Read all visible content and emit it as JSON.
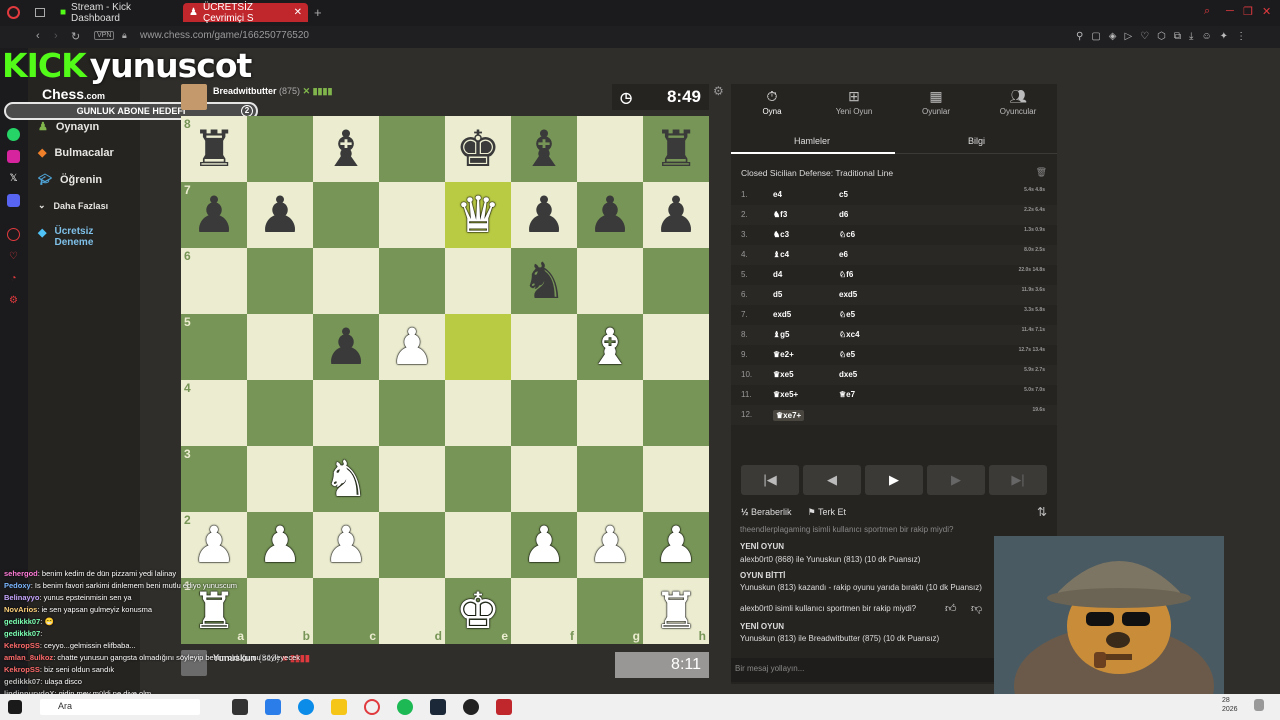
{
  "browser": {
    "tab1": "Stream - Kick Dashboard",
    "tab2": "ÜCRETSİZ Çevrimiçi S",
    "url": "www.chess.com/game/166250776520",
    "vpn": "VPN"
  },
  "overlay": {
    "kick": "KICK",
    "streamer": "yunuscot",
    "goal_label": "GUNLUK ABONE HEDEFI",
    "goal_count": "2"
  },
  "sidebar": {
    "brand": "Chess",
    "brand_suffix": ".com",
    "items": [
      "Oynayın",
      "Bulmacalar",
      "Öğrenin",
      "Daha Fazlası"
    ],
    "premium": "Ücretsiz Deneme"
  },
  "top_player": {
    "name": "Breadwitbutter",
    "rating": "(875)",
    "clock": "8:49"
  },
  "bottom_player": {
    "name": "Yunuskun",
    "rating": "(813)",
    "clock": "8:11"
  },
  "board": {
    "ranks": [
      "8",
      "7",
      "6",
      "5",
      "4",
      "3",
      "2",
      "1"
    ],
    "files": [
      "a",
      "b",
      "c",
      "d",
      "e",
      "f",
      "g",
      "h"
    ],
    "rows": [
      [
        "br",
        "",
        "bb",
        "",
        "bk",
        "bb",
        "",
        "br"
      ],
      [
        "bp",
        "bp",
        "",
        "",
        "wq",
        "bp",
        "bp",
        "bp"
      ],
      [
        "",
        "",
        "",
        "",
        "",
        "bn",
        "",
        ""
      ],
      [
        "",
        "",
        "bp",
        "wp",
        "",
        "",
        "wb",
        ""
      ],
      [
        "",
        "",
        "",
        "",
        "",
        "",
        "",
        ""
      ],
      [
        "",
        "",
        "wn",
        "",
        "",
        "",
        "",
        ""
      ],
      [
        "wp",
        "wp",
        "wp",
        "",
        "",
        "wp",
        "wp",
        "wp"
      ],
      [
        "wr",
        "",
        "",
        "",
        "wk",
        "",
        "",
        "wr"
      ]
    ],
    "highlight": [
      "e7",
      "e5"
    ]
  },
  "panel": {
    "tabs": [
      "Oyna",
      "Yeni Oyun",
      "Oyunlar",
      "Oyuncular"
    ],
    "subtabs": [
      "Hamleler",
      "Bilgi"
    ],
    "opening": "Closed Sicilian Defense: Traditional Line",
    "moves": [
      {
        "n": "1.",
        "w": "e4",
        "b": "c5",
        "t": "5.4s 4.8s"
      },
      {
        "n": "2.",
        "w": "♞f3",
        "b": "d6",
        "t": "2.2s 6.4s"
      },
      {
        "n": "3.",
        "w": "♞c3",
        "b": "♘c6",
        "t": "1.3s 0.9s"
      },
      {
        "n": "4.",
        "w": "♝c4",
        "b": "e6",
        "t": "8.0s 2.5s"
      },
      {
        "n": "5.",
        "w": "d4",
        "b": "♘f6",
        "t": "22.0s 14.8s"
      },
      {
        "n": "6.",
        "w": "d5",
        "b": "exd5",
        "t": "11.9s 3.6s"
      },
      {
        "n": "7.",
        "w": "exd5",
        "b": "♘e5",
        "t": "3.3s 5.8s"
      },
      {
        "n": "8.",
        "w": "♝g5",
        "b": "♘xc4",
        "t": "11.4s 7.1s"
      },
      {
        "n": "9.",
        "w": "♛e2+",
        "b": "♘e5",
        "t": "12.7s 13.4s"
      },
      {
        "n": "10.",
        "w": "♛xe5",
        "b": "dxe5",
        "t": "5.9s 2.7s"
      },
      {
        "n": "11.",
        "w": "♛xe5+",
        "b": "♕e7",
        "t": "5.0s 7.0s"
      },
      {
        "n": "12.",
        "w": "♛xe7+",
        "b": "",
        "t": "19.6s"
      }
    ],
    "draw": "Beraberlik",
    "resign": "Terk Et"
  },
  "chat": {
    "lines": [
      "theendlerplagaming isimli kullanıcı sportmen bir rakip miydi?",
      "YENİ OYUN",
      "alexb0rt0 (868) ile Yunuskun (813) (10 dk Puansız)",
      "OYUN BİTTİ",
      "Yunuskun (813) kazandı - rakip oyunu yarıda bıraktı (10 dk Puansız)",
      "alexb0rt0 isimli kullanıcı sportmen bir rakip miydi?",
      "YENİ OYUN",
      "Yunuskun (813) ile Breadwitbutter (875) (10 dk Puansız)"
    ],
    "placeholder": "Bir mesaj yollayın..."
  },
  "stream_chat": [
    {
      "u": "sehergod",
      "m": ": benim kedim de dün pizzami yedi lalinay"
    },
    {
      "u": "Pedoxy",
      "m": ": Is benim favori sarkimi dinlemem beni mutlu ediyo yunuscum"
    },
    {
      "u": "Belinayyo",
      "m": ": yunus epsteinmisin sen ya"
    },
    {
      "u": "NovArios",
      "m": ": ie sen yapsan gulmeyiz konusma"
    },
    {
      "u": "gedikkk07",
      "m": ": 😁"
    },
    {
      "u": "gedikkk07",
      "m": ": "
    },
    {
      "u": "KekropSS",
      "m": ": ceyyo...gelmissin elifbaba..."
    },
    {
      "u": "amlan_8ulkoz",
      "m": ": chatte yunusun gangsta olmadığını söyleyip benim olduğumu söyleyecek"
    },
    {
      "u": "KekropSS",
      "m": ": biz seni oldun sandık"
    },
    {
      "u": "gedikkk07",
      "m": ": ulaşa disco"
    },
    {
      "u": "lindinnurydoX",
      "m": ": gidin mey müldi ne diye olm"
    }
  ],
  "taskbar": {
    "search": "Ara",
    "date": "28\n2026"
  }
}
